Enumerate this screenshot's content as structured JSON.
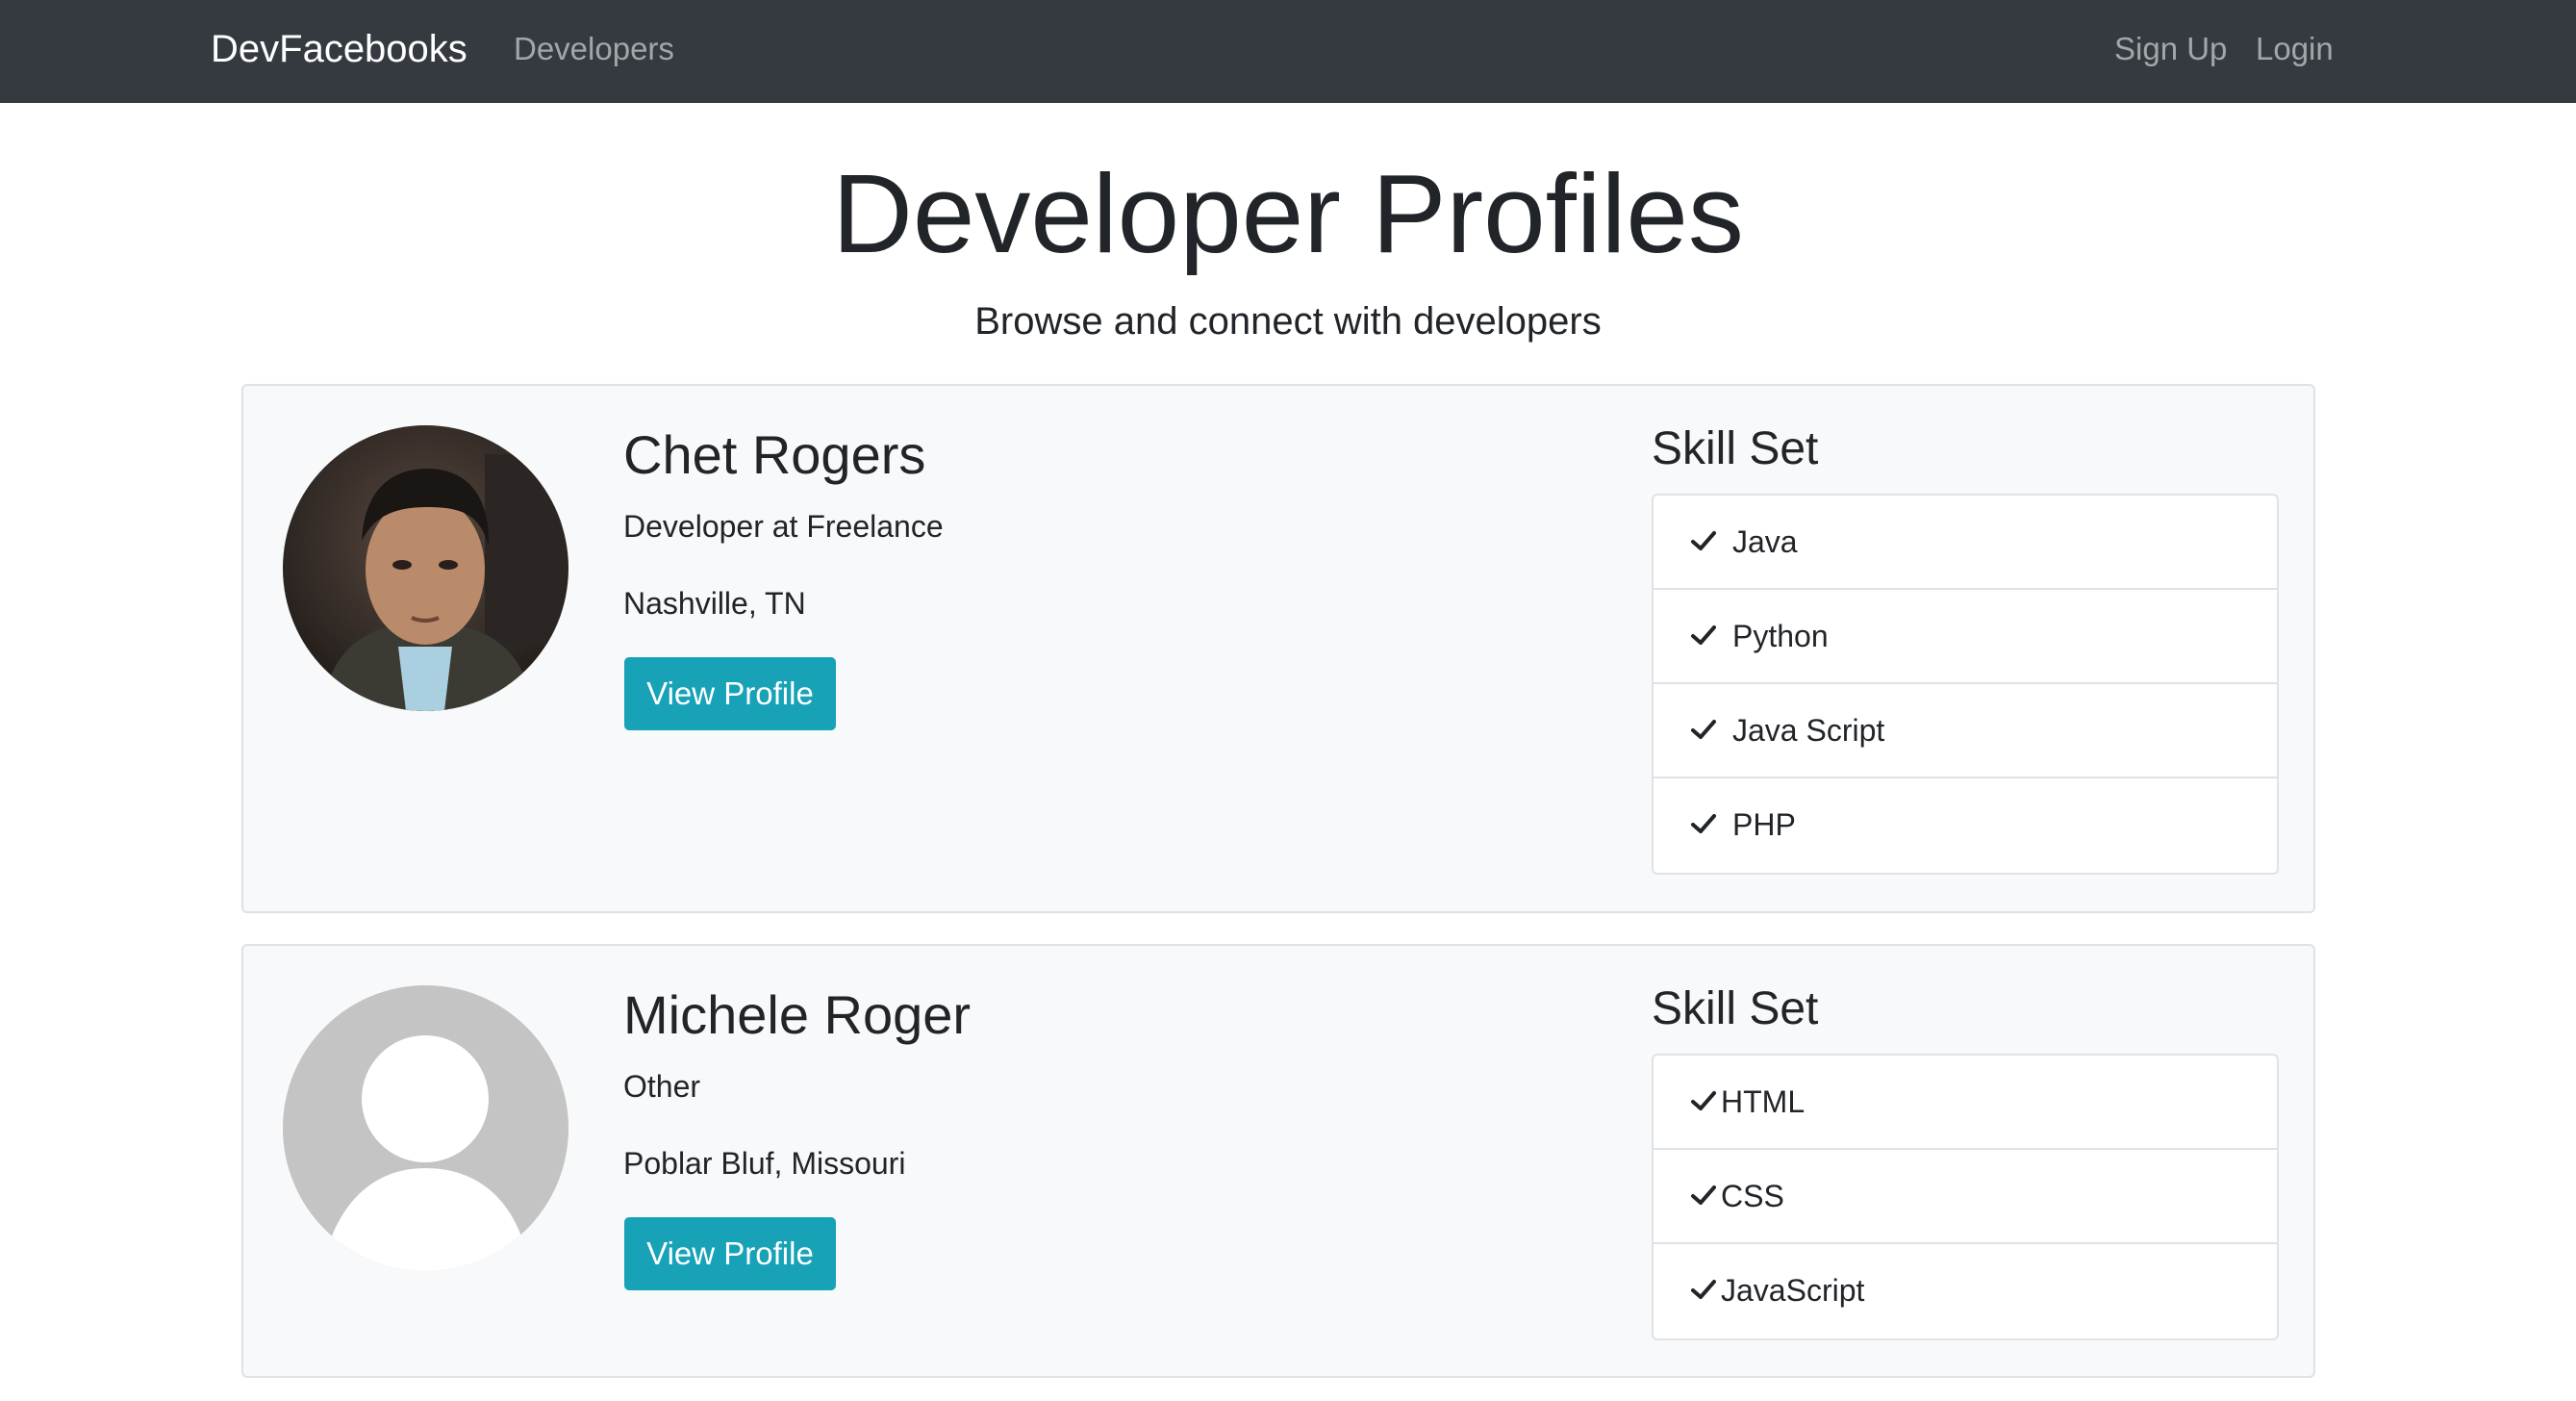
{
  "navbar": {
    "brand": "DevFacebooks",
    "links": {
      "developers": "Developers",
      "signup": "Sign Up",
      "login": "Login"
    }
  },
  "page": {
    "title": "Developer Profiles",
    "subtitle": "Browse and connect with developers"
  },
  "profiles": [
    {
      "name": "Chet Rogers",
      "status": "Developer at Freelance",
      "location": "Nashville, TN",
      "button": "View Profile",
      "skill_title": "Skill Set",
      "skills": [
        "Java",
        "Python",
        "Java Script",
        "PHP"
      ]
    },
    {
      "name": "Michele Roger",
      "status": "Other",
      "location": "Poblar Bluf, Missouri",
      "button": "View Profile",
      "skill_title": "Skill Set",
      "skills": [
        "HTML",
        "CSS",
        "JavaScript"
      ]
    }
  ],
  "colors": {
    "navbar_bg": "#343a40",
    "button_bg": "#17a2b8",
    "card_bg": "#f8f9fa"
  },
  "icons": {
    "skill": "check-icon",
    "avatar_placeholder": "user-silhouette-icon"
  }
}
